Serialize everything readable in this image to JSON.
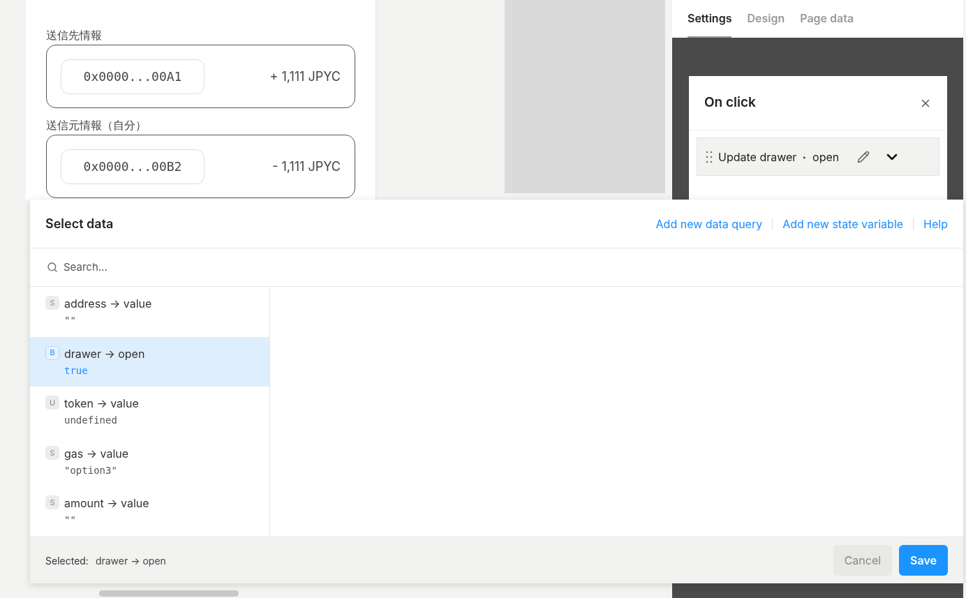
{
  "form": {
    "sections": [
      {
        "label": "送信先情報",
        "address": "0x0000...00A1",
        "amount": "+ 1,111 JPYC"
      },
      {
        "label": "送信元情報（自分）",
        "address": "0x0000...00B2",
        "amount": "- 1,111 JPYC"
      }
    ]
  },
  "inspector": {
    "tabs": [
      {
        "label": "Settings",
        "selected": true
      },
      {
        "label": "Design",
        "selected": false
      },
      {
        "label": "Page data",
        "selected": false
      }
    ],
    "event_panel": {
      "title": "On click",
      "action": {
        "label": "Update drawer",
        "arrow": "‣",
        "target": "open",
        "expanded": true
      }
    }
  },
  "dialog": {
    "title": "Select data",
    "links": [
      "Add new data query",
      "Add new state variable",
      "Help"
    ],
    "search": {
      "placeholder": "Search..."
    },
    "items": [
      {
        "badge": "S",
        "name": "address → value",
        "value": "\"\"",
        "selected": false
      },
      {
        "badge": "B",
        "name": "drawer → open",
        "value": "true",
        "selected": true
      },
      {
        "badge": "U",
        "name": "token → value",
        "value": "undefined",
        "selected": false
      },
      {
        "badge": "S",
        "name": "gas → value",
        "value": "\"option3\"",
        "selected": false
      },
      {
        "badge": "S",
        "name": "amount → value",
        "value": "\"\"",
        "selected": false
      }
    ],
    "footer": {
      "label": "Selected:",
      "value": "drawer → open",
      "buttons": [
        {
          "label": "Cancel",
          "kind": "secondary"
        },
        {
          "label": "Save",
          "kind": "primary"
        }
      ]
    }
  }
}
